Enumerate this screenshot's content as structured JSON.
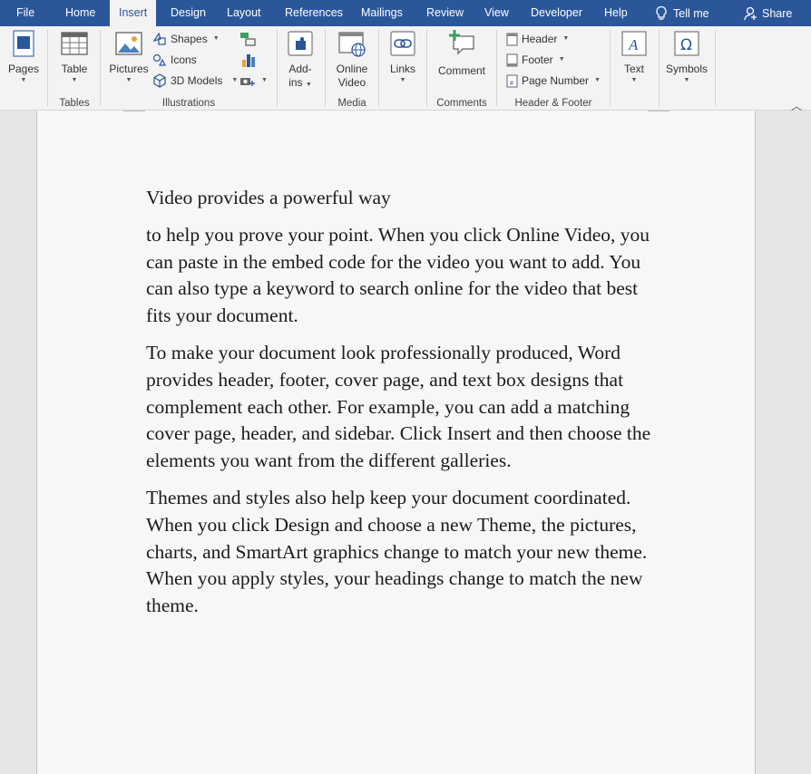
{
  "tabs": [
    {
      "label": "File"
    },
    {
      "label": "Home"
    },
    {
      "label": "Insert"
    },
    {
      "label": "Design"
    },
    {
      "label": "Layout"
    },
    {
      "label": "References"
    },
    {
      "label": "Mailings"
    },
    {
      "label": "Review"
    },
    {
      "label": "View"
    },
    {
      "label": "Developer"
    },
    {
      "label": "Help"
    }
  ],
  "active_tab": "Insert",
  "tell_me": "Tell me",
  "share": "Share",
  "ribbon": {
    "pages": {
      "label": "Pages"
    },
    "tables": {
      "button": "Table",
      "group": "Tables"
    },
    "illustrations": {
      "pictures": "Pictures",
      "shapes": "Shapes",
      "icons": "Icons",
      "models": "3D Models",
      "group": "Illustrations"
    },
    "addins": {
      "line1": "Add-",
      "line2": "ins"
    },
    "media": {
      "line1": "Online",
      "line2": "Video",
      "group": "Media"
    },
    "links": {
      "label": "Links"
    },
    "comments": {
      "button": "Comment",
      "group": "Comments"
    },
    "header_footer": {
      "header": "Header",
      "footer": "Footer",
      "page_number": "Page Number",
      "group": "Header & Footer"
    },
    "text": {
      "label": "Text"
    },
    "symbols": {
      "label": "Symbols"
    }
  },
  "colors": {
    "accent": "#2b579a",
    "ribbon_bg": "#f3f3f3",
    "page_bg": "#f7f7f7"
  },
  "document": {
    "paragraphs": [
      "Video provides a powerful way",
      "to help you prove your point. When you click Online Video, you can paste in the embed code for the video you want to add. You can also type a keyword to search online for the video that best fits your document.",
      "To make your document look professionally produced, Word provides header, footer, cover page, and text box designs that complement each other. For example, you can add a matching cover page, header, and sidebar. Click Insert and then choose the elements you want from the different galleries.",
      "Themes and styles also help keep your document coordinated. When you click Design and choose a new Theme, the pictures, charts, and SmartArt graphics change to match your new theme. When you apply styles, your headings change to match the new theme."
    ]
  }
}
